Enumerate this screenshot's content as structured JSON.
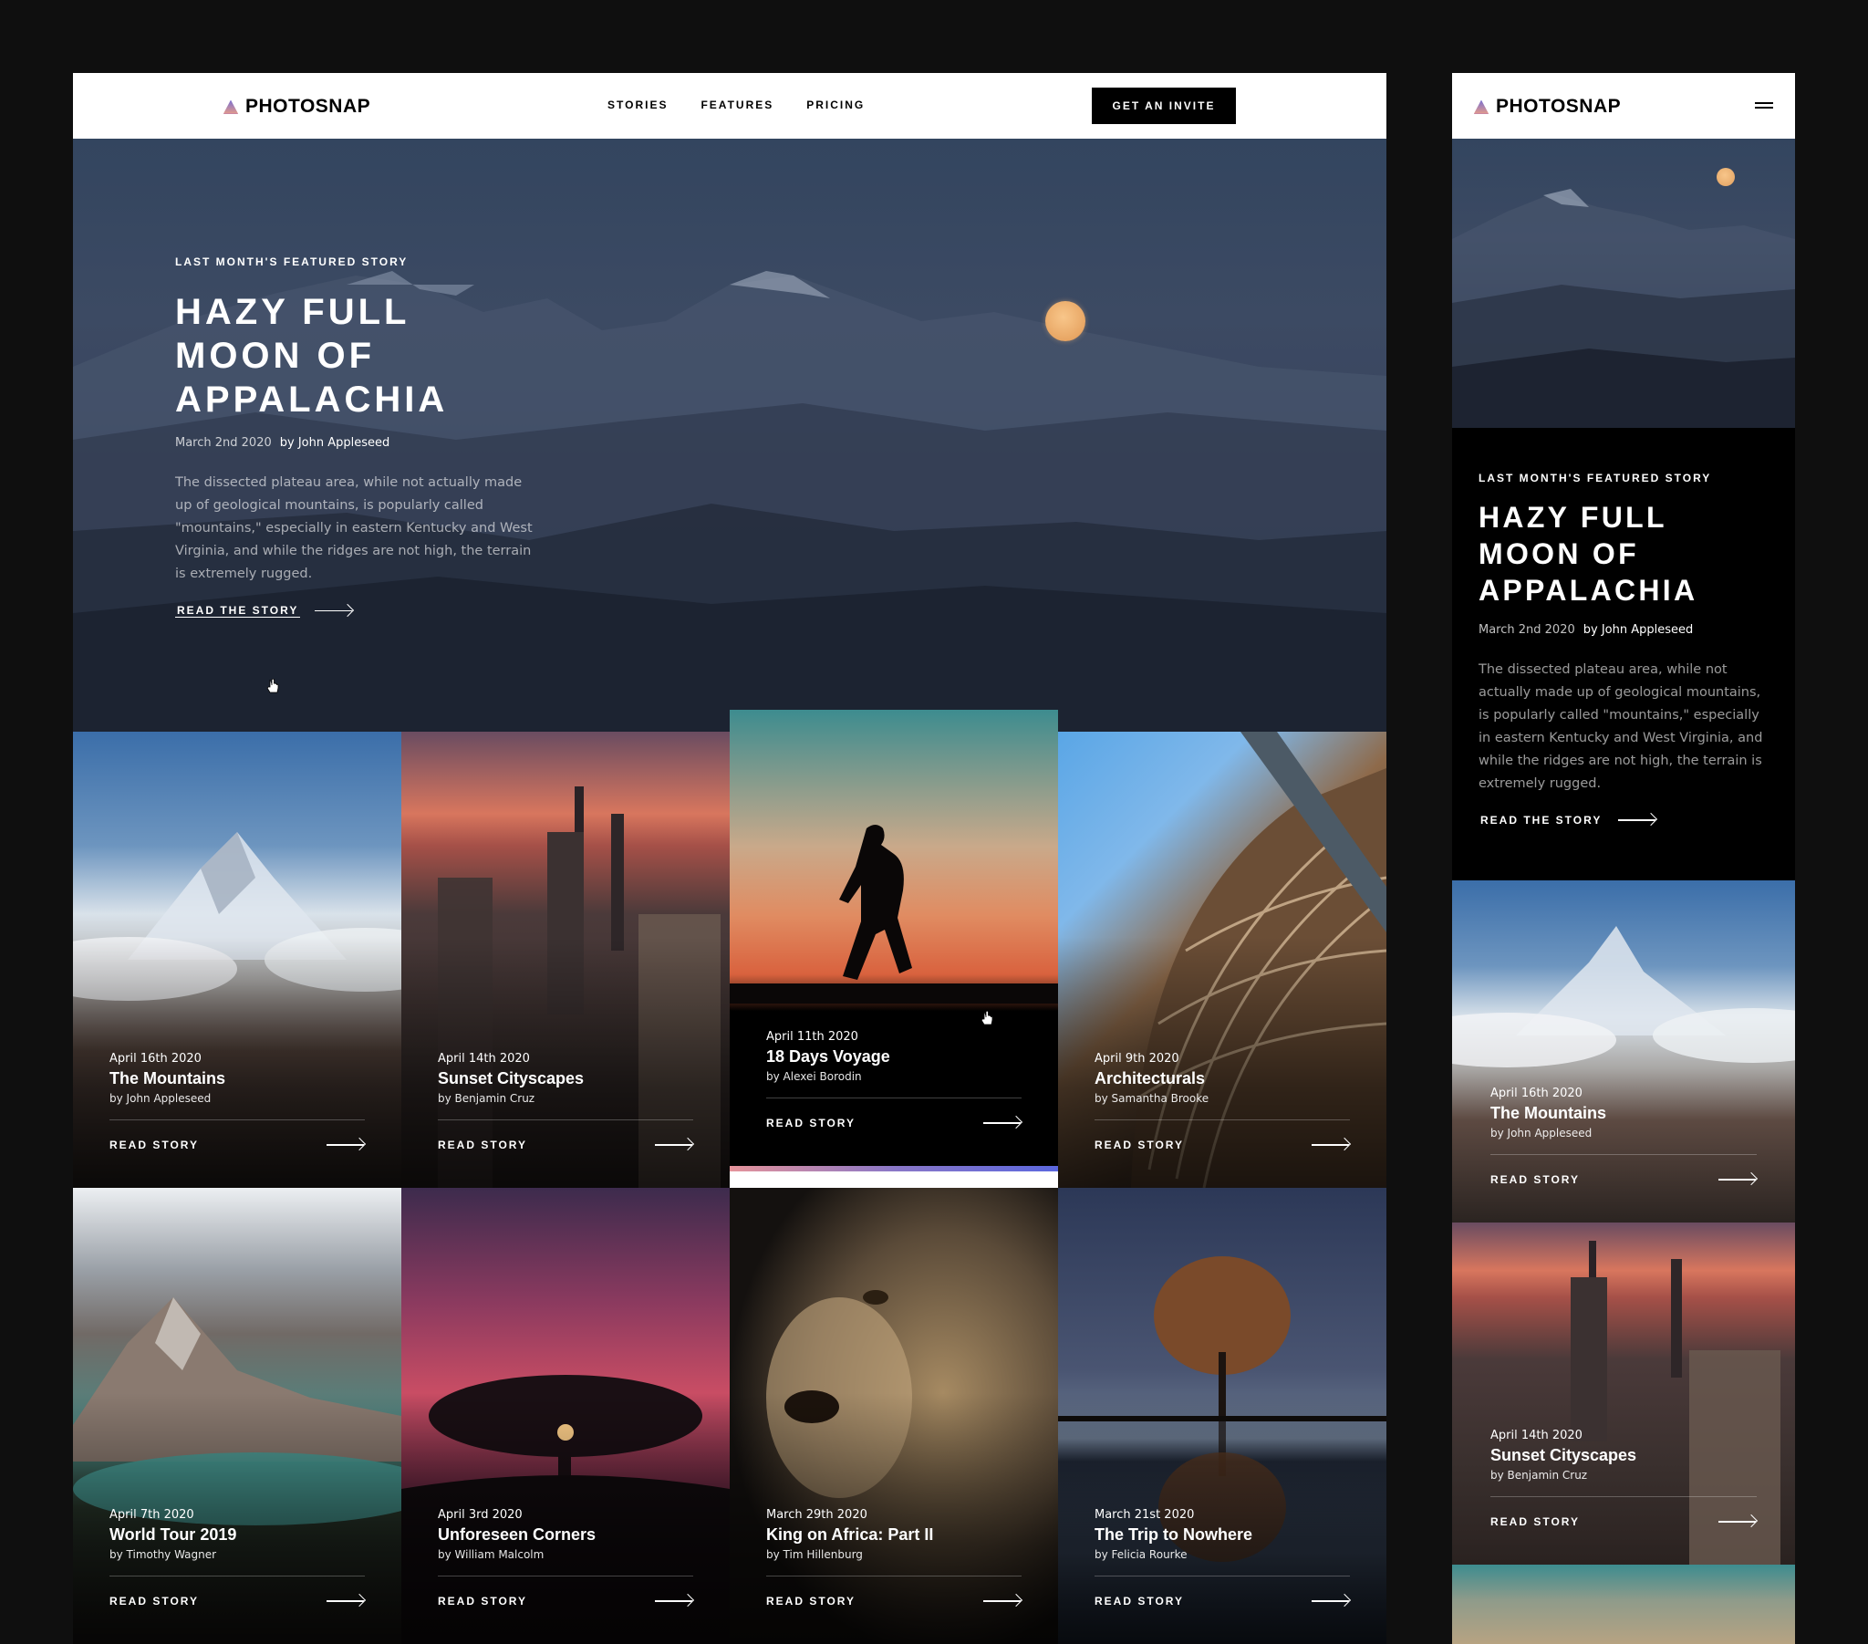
{
  "brand": {
    "name": "PHOTOSNAP"
  },
  "desktop": {
    "nav": {
      "links": [
        "STORIES",
        "FEATURES",
        "PRICING"
      ],
      "cta_label": "GET AN INVITE"
    },
    "hero": {
      "eyebrow": "LAST MONTH'S FEATURED STORY",
      "title": "HAZY FULL\nMOON OF\nAPPALACHIA",
      "date": "March 2nd 2020",
      "author": "by John Appleseed",
      "description": "The dissected plateau area, while not actually made up of geological mountains, is popularly called \"mountains,\" especially in eastern Kentucky and West Virginia, and while the ridges are not high, the terrain is extremely rugged.",
      "read_label": "READ THE STORY"
    },
    "stories": [
      {
        "date": "April 16th 2020",
        "title": "The Mountains",
        "author": "by John Appleseed",
        "read_label": "READ STORY"
      },
      {
        "date": "April 14th 2020",
        "title": "Sunset Cityscapes",
        "author": "by Benjamin Cruz",
        "read_label": "READ STORY"
      },
      {
        "date": "April 11th 2020",
        "title": "18 Days Voyage",
        "author": "by Alexei Borodin",
        "read_label": "READ STORY"
      },
      {
        "date": "April 9th 2020",
        "title": "Architecturals",
        "author": "by Samantha Brooke",
        "read_label": "READ STORY"
      },
      {
        "date": "April 7th 2020",
        "title": "World Tour 2019",
        "author": "by Timothy Wagner",
        "read_label": "READ STORY"
      },
      {
        "date": "April 3rd 2020",
        "title": "Unforeseen Corners",
        "author": "by William Malcolm",
        "read_label": "READ STORY"
      },
      {
        "date": "March 29th 2020",
        "title": "King on Africa: Part II",
        "author": "by Tim Hillenburg",
        "read_label": "READ STORY"
      },
      {
        "date": "March 21st 2020",
        "title": "The Trip to Nowhere",
        "author": "by Felicia Rourke",
        "read_label": "READ STORY"
      }
    ]
  },
  "mobile": {
    "hero": {
      "eyebrow": "LAST MONTH'S FEATURED STORY",
      "title": "HAZY FULL\nMOON OF\nAPPALACHIA",
      "date": "March 2nd 2020",
      "author": "by John Appleseed",
      "description": "The dissected plateau area, while not actually made up of geological mountains, is popularly called \"mountains,\" especially in eastern Kentucky and West Virginia, and while the ridges are not high, the terrain is extremely rugged.",
      "read_label": "READ THE STORY"
    },
    "stories": [
      {
        "date": "April 16th 2020",
        "title": "The Mountains",
        "author": "by John Appleseed",
        "read_label": "READ STORY"
      },
      {
        "date": "April 14th 2020",
        "title": "Sunset Cityscapes",
        "author": "by Benjamin Cruz",
        "read_label": "READ STORY"
      }
    ]
  },
  "icons": {
    "logo": "triangle-gradient-icon",
    "menu": "hamburger-menu-icon",
    "arrow": "arrow-right-icon",
    "cursor": "hand-pointer-cursor"
  },
  "colors": {
    "background": "#0f0f0f",
    "nav_bg": "#ffffff",
    "cta_bg": "#000000",
    "text_light": "#ffffff",
    "accent_gradient_start": "#ffc593",
    "accent_gradient_mid": "#bc7198",
    "accent_gradient_end": "#5a77ff"
  }
}
